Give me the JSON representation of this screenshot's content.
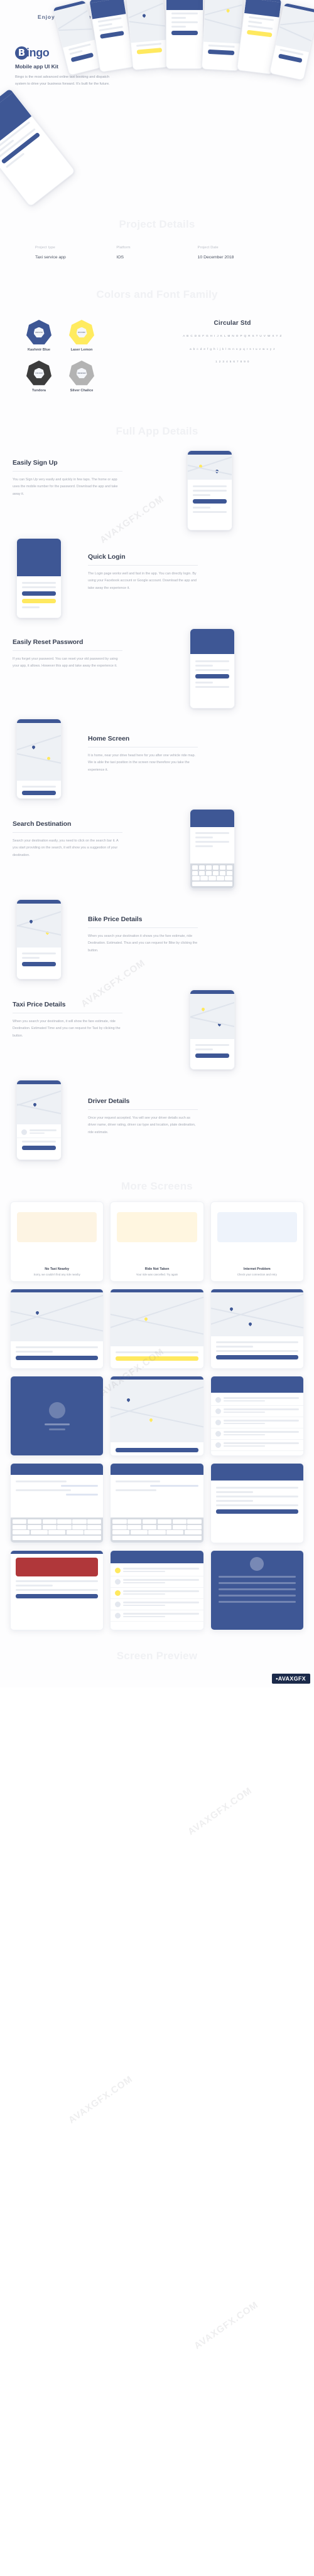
{
  "meta": {
    "watermark_text": "AVAXGFX.COM",
    "badge_text": "AVAXGFX",
    "badge_dot": "•"
  },
  "hero": {
    "tagline": "Enjoy the experience.",
    "logo_mark": "B",
    "logo_text": "ingo",
    "subtitle": "Mobile app UI Kit",
    "description": "Bingo is the most advanced online taxi booking and dispatch system to drive your business forward. It's built for the future."
  },
  "sections": {
    "project_details": "Project Details",
    "colors_and_fonts": "Colors and Font Family",
    "full_app_details": "Full App Details",
    "more_screens": "More Screens",
    "screen_preview": "Screen Preview"
  },
  "project_details": {
    "columns": [
      {
        "label": "Project type",
        "value": "Taxi service app"
      },
      {
        "label": "Platform",
        "value": "IOS"
      },
      {
        "label": "Project Date",
        "value": "10 December 2018"
      }
    ]
  },
  "colors": [
    {
      "name": "Kashmir Blue",
      "hex": "#3E5795",
      "chip": "#3E5795"
    },
    {
      "name": "Laser Lemon",
      "hex": "#FFF85F",
      "chip": "#FFEB5F"
    },
    {
      "name": "Tundora",
      "hex": "#404040",
      "chip": "#3C3C3C"
    },
    {
      "name": "Silver Chalice",
      "hex": "#B0B0B0",
      "chip": "#B3B3B3"
    }
  ],
  "font": {
    "name": "Circular Std",
    "uppercase": "A B C D E F G H I J K L M N O P Q R S T U V W X Y Z",
    "lowercase": "a b c d e f g h i j k l m n o p q r s t u v w x y z",
    "numerals": "1 2 3 4 5 6 7 8 9 0"
  },
  "features": [
    {
      "title": "Easily Sign Up",
      "body": "You can Sign Up very easily and quickly in few taps. The home or app uses the mobile number for the password. Download the app and take away it."
    },
    {
      "title": "Quick Login",
      "body": "The Login page works well and fast in the app. You can directly login. By using your Facebook account or Google account. Download the app and take away the experience it."
    },
    {
      "title": "Easily Reset Password",
      "body": "If you forget your password. You can reset your old password by using your app, it allows. However this app and take away the experience it."
    },
    {
      "title": "Home Screen",
      "body": "It is home, near your drive head here for you after one vehicle ride map. We is able the taxi position in the screen now therefore you take the experience it."
    },
    {
      "title": "Search Destination",
      "body": "Search your destination easily, you need to click on the search bar it. A you start providing on the search, it will show you a suggestion of your destination."
    },
    {
      "title": "Bike Price Details",
      "body": "When you search your destination it shows you the fare estimate, ride Destination. Estimated. Thus and you can request for Bike by clicking the button."
    },
    {
      "title": "Taxi Price Details",
      "body": "When you search your destination, it will show the fare estimate, ride Destination. Estimated Time and you can request for Taxi by clicking the button."
    },
    {
      "title": "Driver Details",
      "body": "Once your request accepted. You will see your driver details such as driver name, driver rating, driver car type and location, plate destination, ride estimate."
    }
  ],
  "gallery": {
    "cards": [
      {
        "title": "No Taxi Nearby",
        "caption": "Sorry, we couldn't find any ride nearby"
      },
      {
        "title": "Ride Not Taken",
        "caption": "Your ride was cancelled. Try again"
      },
      {
        "title": "Internet Problem",
        "caption": "Check your connection and retry"
      }
    ]
  }
}
